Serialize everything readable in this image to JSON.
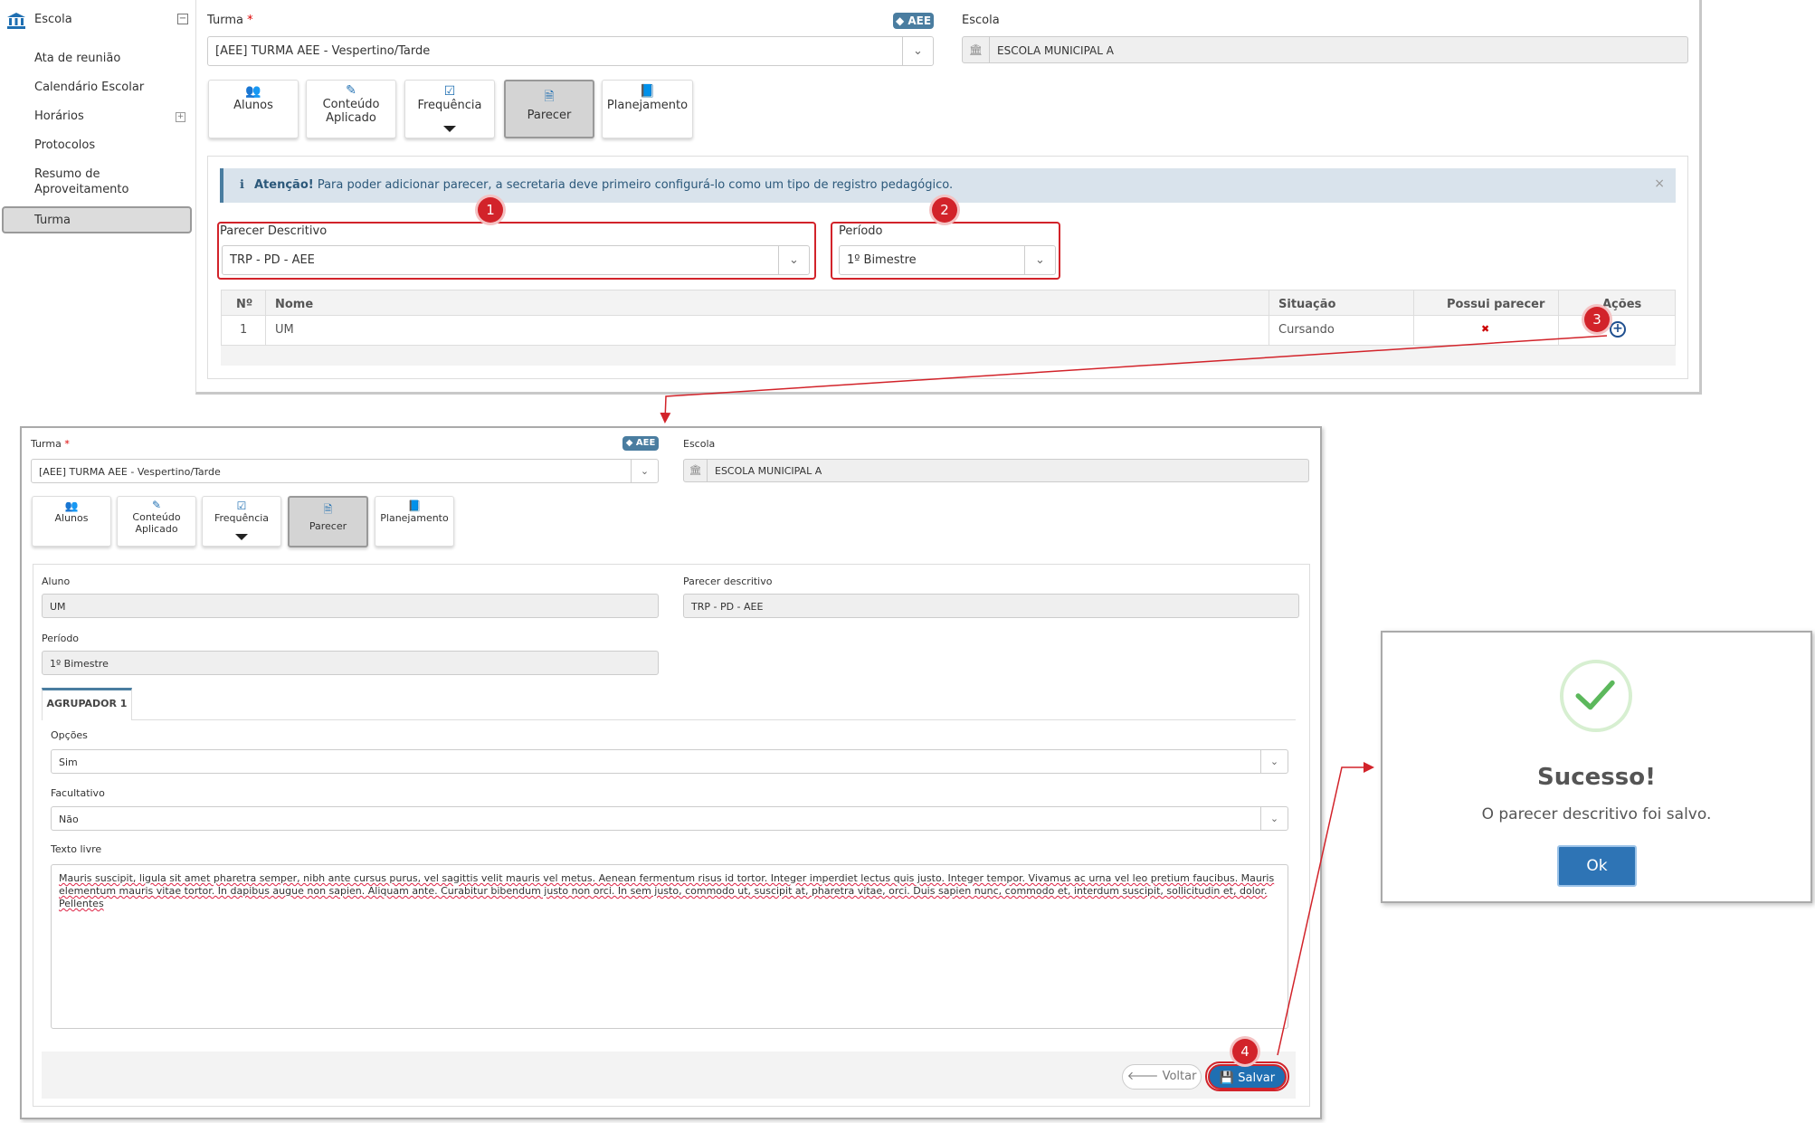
{
  "sidebar": {
    "title": "Escola",
    "items": [
      {
        "label": "Ata de reunião"
      },
      {
        "label": "Calendário Escolar"
      },
      {
        "label": "Horários"
      },
      {
        "label": "Protocolos"
      },
      {
        "label": "Resumo de Aproveitamento"
      },
      {
        "label": "Turma"
      }
    ]
  },
  "panel1": {
    "turma_label": "Turma",
    "required_mark": "*",
    "aee_badge": "AEE",
    "turma_value": "[AEE]  TURMA AEE - Vespertino/Tarde",
    "escola_label": "Escola",
    "escola_value": "ESCOLA MUNICIPAL A",
    "tabs": [
      {
        "line1": "Alunos",
        "line2": ""
      },
      {
        "line1": "Conteúdo",
        "line2": "Aplicado"
      },
      {
        "line1": "Frequência",
        "line2": ""
      },
      {
        "line1": "Parecer",
        "line2": ""
      },
      {
        "line1": "Planejamento",
        "line2": ""
      }
    ],
    "alert_icon": "ℹ",
    "alert_strong": "Atenção!",
    "alert_text": "Para poder adicionar parecer, a secretaria deve primeiro configurá-lo como um tipo de registro pedagógico.",
    "alert_close": "×",
    "parecer_label": "Parecer Descritivo",
    "parecer_value": "TRP - PD - AEE",
    "periodo_label": "Período",
    "periodo_value": "1º Bimestre",
    "table": {
      "headers": [
        "Nº",
        "Nome",
        "Situação",
        "Possui parecer",
        "Ações"
      ],
      "rows": [
        {
          "num": "1",
          "nome": "UM",
          "situacao": "Cursando",
          "possui": "✖",
          "acao": "+"
        }
      ]
    }
  },
  "panel2": {
    "turma_label": "Turma",
    "required_mark": "*",
    "aee_badge": "AEE",
    "turma_value": "[AEE]  TURMA AEE - Vespertino/Tarde",
    "escola_label": "Escola",
    "escola_value": "ESCOLA MUNICIPAL A",
    "tabs": [
      {
        "line1": "Alunos",
        "line2": ""
      },
      {
        "line1": "Conteúdo",
        "line2": "Aplicado"
      },
      {
        "line1": "Frequência",
        "line2": ""
      },
      {
        "line1": "Parecer",
        "line2": ""
      },
      {
        "line1": "Planejamento",
        "line2": ""
      }
    ],
    "aluno_label": "Aluno",
    "aluno_value": "UM",
    "parecer_label": "Parecer descritivo",
    "parecer_value": "TRP - PD - AEE",
    "periodo_label": "Período",
    "periodo_value": "1º Bimestre",
    "group_tab": "AGRUPADOR 1",
    "opcoes_label": "Opções",
    "opcoes_value": "Sim",
    "facultativo_label": "Facultativo",
    "facultativo_value": "Não",
    "texto_label": "Texto livre",
    "texto_value": "Mauris suscipit, ligula sit amet pharetra semper, nibh ante cursus purus, vel sagittis velit mauris vel metus. Aenean fermentum risus id tortor. Integer imperdiet lectus quis justo. Integer tempor. Vivamus ac urna vel leo pretium faucibus. Mauris elementum mauris vitae tortor. In dapibus augue non sapien. Aliquam ante. Curabitur bibendum justo non orci. In sem justo, commodo ut, suscipit at, pharetra vitae, orci. Duis sapien nunc, commodo et, interdum suscipit, sollicitudin et, dolor. Pellentes",
    "voltar_icon": "🡐",
    "voltar_label": "Voltar",
    "salvar_label": "Salvar"
  },
  "modal": {
    "title": "Sucesso!",
    "message": "O parecer descritivo foi salvo.",
    "ok_label": "Ok"
  },
  "annotations": [
    "1",
    "2",
    "3",
    "4"
  ],
  "colors": {
    "accent": "#1f6fb2",
    "badge": "#4a7da0",
    "annotation": "#d2232a",
    "success": "#5cb85c"
  }
}
